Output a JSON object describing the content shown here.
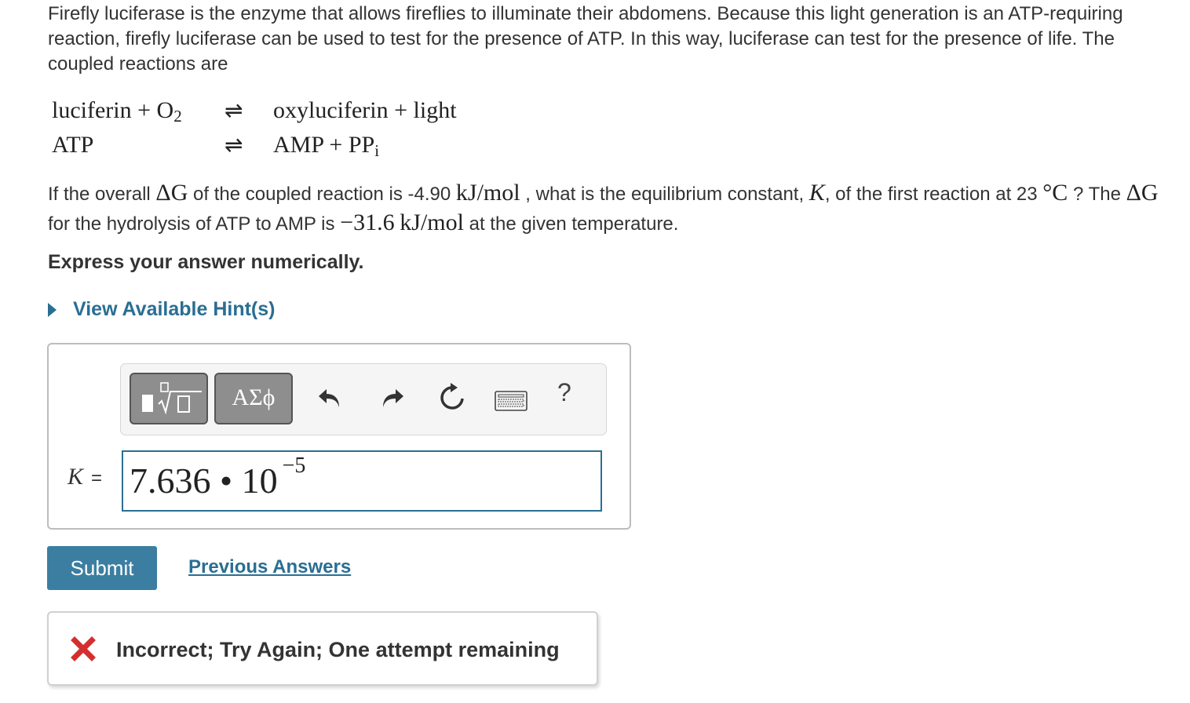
{
  "intro": "Firefly luciferase is the enzyme that allows fireflies to illuminate their abdomens. Because this light generation is an ATP-requiring reaction, firefly luciferase can be used to test for the presence of ATP. In this way, luciferase can test for the presence of life. The coupled reactions are",
  "reactions": [
    {
      "left": "luciferin + O",
      "left_sub": "2",
      "arrow": "⇌",
      "right": "oxyluciferin + light",
      "right_sub": ""
    },
    {
      "left": "ATP",
      "left_sub": "",
      "arrow": "⇌",
      "right": "AMP + PP",
      "right_sub": "i"
    }
  ],
  "question": {
    "p1": "If the overall ",
    "delta_g": "ΔG",
    "p2": " of the coupled reaction is -4.90 ",
    "unit1": "kJ/mol",
    "p3": " , what is the equilibrium constant, ",
    "k_sym": "K",
    "p4": ", of the first reaction at 23 ",
    "deg": "°C",
    "p5": " ? The ",
    "delta_g2": "ΔG",
    "p6": " for the hydrolysis of ATP to AMP is ",
    "neg_val": "−31.6",
    "unit2": "kJ/mol",
    "p7": " at the given temperature."
  },
  "express": "Express your answer numerically.",
  "hint_label": "View Available Hint(s)",
  "toolbar": {
    "templates_icon": "templates-icon",
    "symbols_label": "ΑΣϕ",
    "undo_icon": "undo-icon",
    "redo_icon": "redo-icon",
    "reset_icon": "reset-icon",
    "keyboard_icon": "keyboard-icon",
    "help_label": "?"
  },
  "answer": {
    "variable": "K",
    "equals": "=",
    "mantissa": "7.636 • 10",
    "exponent": "−5"
  },
  "submit_label": "Submit",
  "previous_answers_label": "Previous Answers",
  "feedback": {
    "icon": "incorrect-x-icon",
    "text": "Incorrect; Try Again; One attempt remaining",
    "icon_color": "#d32f2f"
  },
  "colors": {
    "accent": "#3b7ea1",
    "link": "#2a6e93"
  }
}
